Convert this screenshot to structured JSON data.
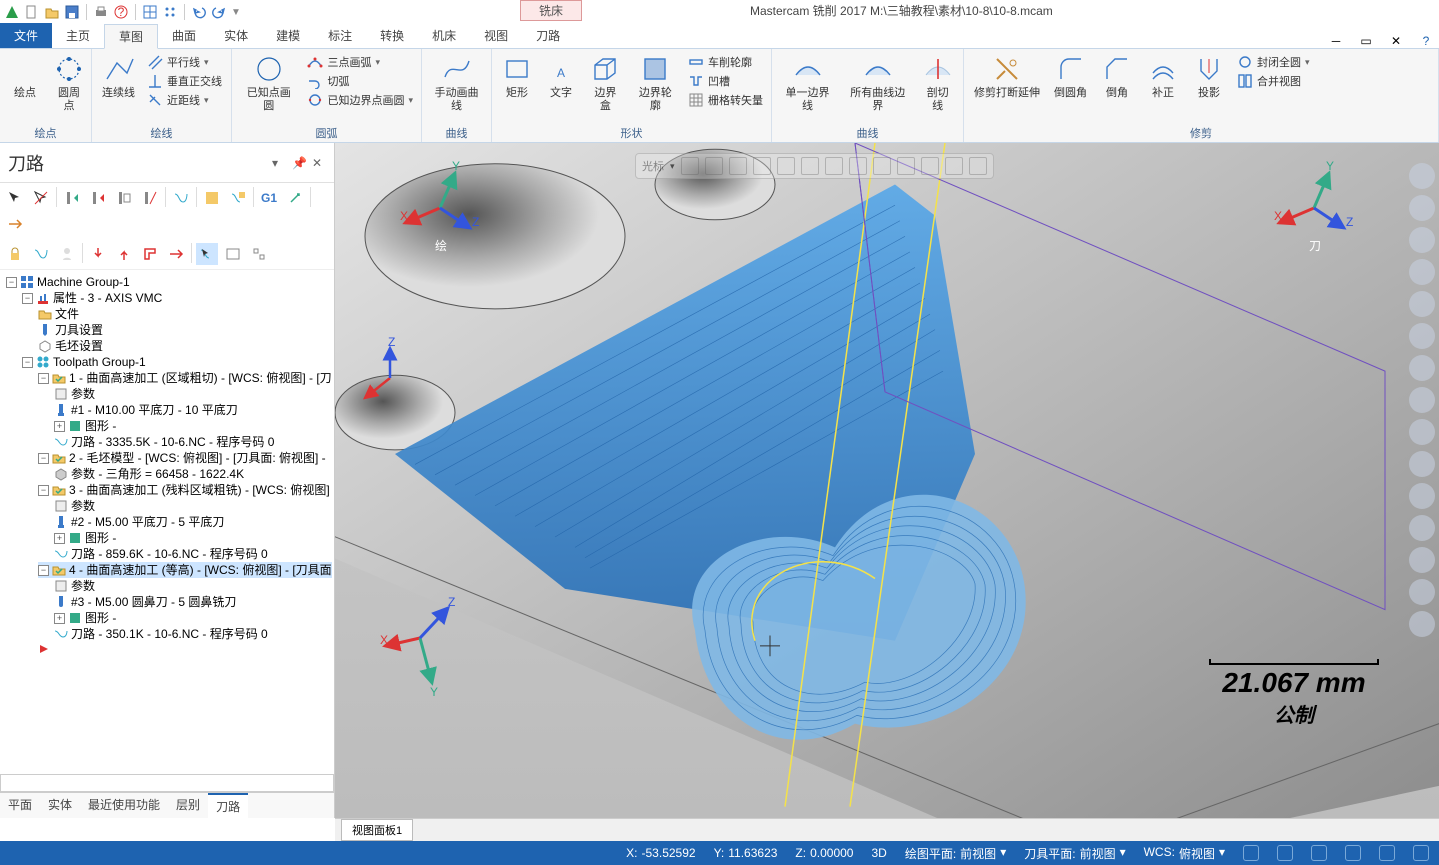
{
  "app": {
    "title": "Mastercam 铣削 2017  M:\\三轴教程\\素材\\10-8\\10-8.mcam",
    "mill_tab": "铣床"
  },
  "tabs": {
    "file": "文件",
    "items": [
      "主页",
      "草图",
      "曲面",
      "实体",
      "建模",
      "标注",
      "转换",
      "机床",
      "视图",
      "刀路"
    ],
    "active": 1
  },
  "ribbon": {
    "group1": {
      "label": "绘点",
      "btn1": "绘点",
      "btn2": "圆周点"
    },
    "group2": {
      "label": "绘线",
      "btn1": "连续线",
      "s1": "平行线",
      "s2": "垂直正交线",
      "s3": "近距线"
    },
    "group3": {
      "label": "圆弧",
      "btn1": "已知点画圆",
      "s1": "三点画弧",
      "s2": "切弧",
      "s3": "已知边界点画圆"
    },
    "group4": {
      "label": "曲线",
      "btn1": "手动画曲线"
    },
    "group5": {
      "label": "形状",
      "b1": "矩形",
      "b2": "文字",
      "b3": "边界盒",
      "b4": "边界轮廓",
      "s1": "车削轮廓",
      "s2": "凹槽",
      "s3": "栅格转矢量"
    },
    "group6": {
      "label": "曲线",
      "b1": "单一边界线",
      "b2": "所有曲线边界",
      "b3": "剖切线"
    },
    "group7": {
      "label": "修剪",
      "b1": "修剪打断延伸",
      "b2": "倒圆角",
      "b3": "倒角",
      "b4": "补正",
      "b5": "投影",
      "s1": "封闭全圆",
      "s2": "合并视图"
    }
  },
  "panel": {
    "title": "刀路",
    "tabs": [
      "平面",
      "实体",
      "最近使用功能",
      "层别",
      "刀路"
    ],
    "active_tab": 4
  },
  "tree": {
    "root": "Machine Group-1",
    "props": "属性 - 3 - AXIS VMC",
    "p1": "文件",
    "p2": "刀具设置",
    "p3": "毛坯设置",
    "tg": "Toolpath Group-1",
    "n1": "1 - 曲面高速加工 (区域粗切) - [WCS: 俯视图] - [刀",
    "n1a": "参数",
    "n1b": "#1 - M10.00 平底刀 - 10 平底刀",
    "n1c": "图形 -",
    "n1d": "刀路 - 3335.5K - 10-6.NC - 程序号码 0",
    "n2": "2 - 毛坯模型 - [WCS: 俯视图] - [刀具面: 俯视图] -",
    "n2a": "参数 - 三角形 =  66458 - 1622.4K",
    "n3": "3 - 曲面高速加工 (残料区域粗铣) - [WCS: 俯视图]",
    "n3a": "参数",
    "n3b": "#2 - M5.00 平底刀 - 5 平底刀",
    "n3c": "图形 -",
    "n3d": "刀路 - 859.6K - 10-6.NC - 程序号码 0",
    "n4": "4 - 曲面高速加工 (等高) - [WCS: 俯视图] - [刀具面",
    "n4a": "参数",
    "n4b": "#3 - M5.00 圆鼻刀 - 5 圆鼻铣刀",
    "n4c": "图形 -",
    "n4d": "刀路 - 350.1K - 10-6.NC - 程序号码 0"
  },
  "viewport": {
    "scale_mm": "21.067 mm",
    "scale_unit": "公制",
    "tab": "视图面板1",
    "gizmo_x": "X",
    "gizmo_y": "Y",
    "gizmo_z": "Z",
    "gizmo_lbl1": "绘",
    "gizmo_lbl2": "刀",
    "cursor_label": "光标"
  },
  "status": {
    "x_label": "X:",
    "x": "-53.52592",
    "y_label": "Y:",
    "y": "11.63623",
    "z_label": "Z:",
    "z": "0.00000",
    "mode": "3D",
    "plane_l": "绘图平面:",
    "plane": "前视图",
    "tool_l": "刀具平面:",
    "tool": "前视图",
    "wcs_l": "WCS:",
    "wcs": "俯视图"
  }
}
